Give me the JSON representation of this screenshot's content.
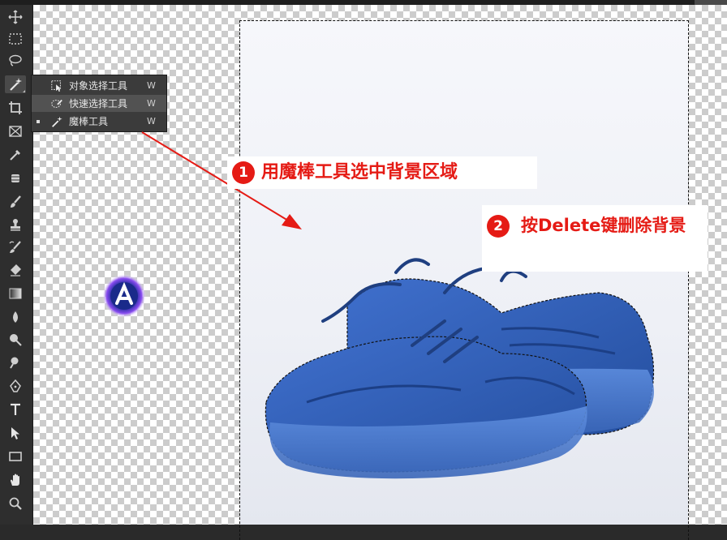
{
  "flyout": {
    "items": [
      {
        "label": "对象选择工具",
        "key": "W",
        "icon": "object-select-icon"
      },
      {
        "label": "快速选择工具",
        "key": "W",
        "icon": "quick-select-icon"
      },
      {
        "label": "魔棒工具",
        "key": "W",
        "icon": "magic-wand-icon"
      }
    ]
  },
  "steps": [
    {
      "number": "1",
      "text": "用魔棒工具选中背景区域"
    },
    {
      "number": "2",
      "text": "按Delete键删除背景"
    }
  ],
  "colors": {
    "accent_red": "#e51b15",
    "shoe_blue": "#2f5fb8",
    "toolbar_bg": "#2e2e2e"
  },
  "toolbar": {
    "tools": [
      "move-icon",
      "marquee-icon",
      "lasso-icon",
      "magic-wand-icon",
      "crop-icon",
      "frame-icon",
      "eyedropper-icon",
      "spot-heal-icon",
      "brush-icon",
      "stamp-icon",
      "history-brush-icon",
      "eraser-icon",
      "gradient-icon",
      "blur-icon",
      "dodge-icon",
      "pen-icon",
      "type-icon",
      "path-select-icon",
      "rectangle-icon",
      "hand-icon",
      "zoom-icon"
    ]
  }
}
